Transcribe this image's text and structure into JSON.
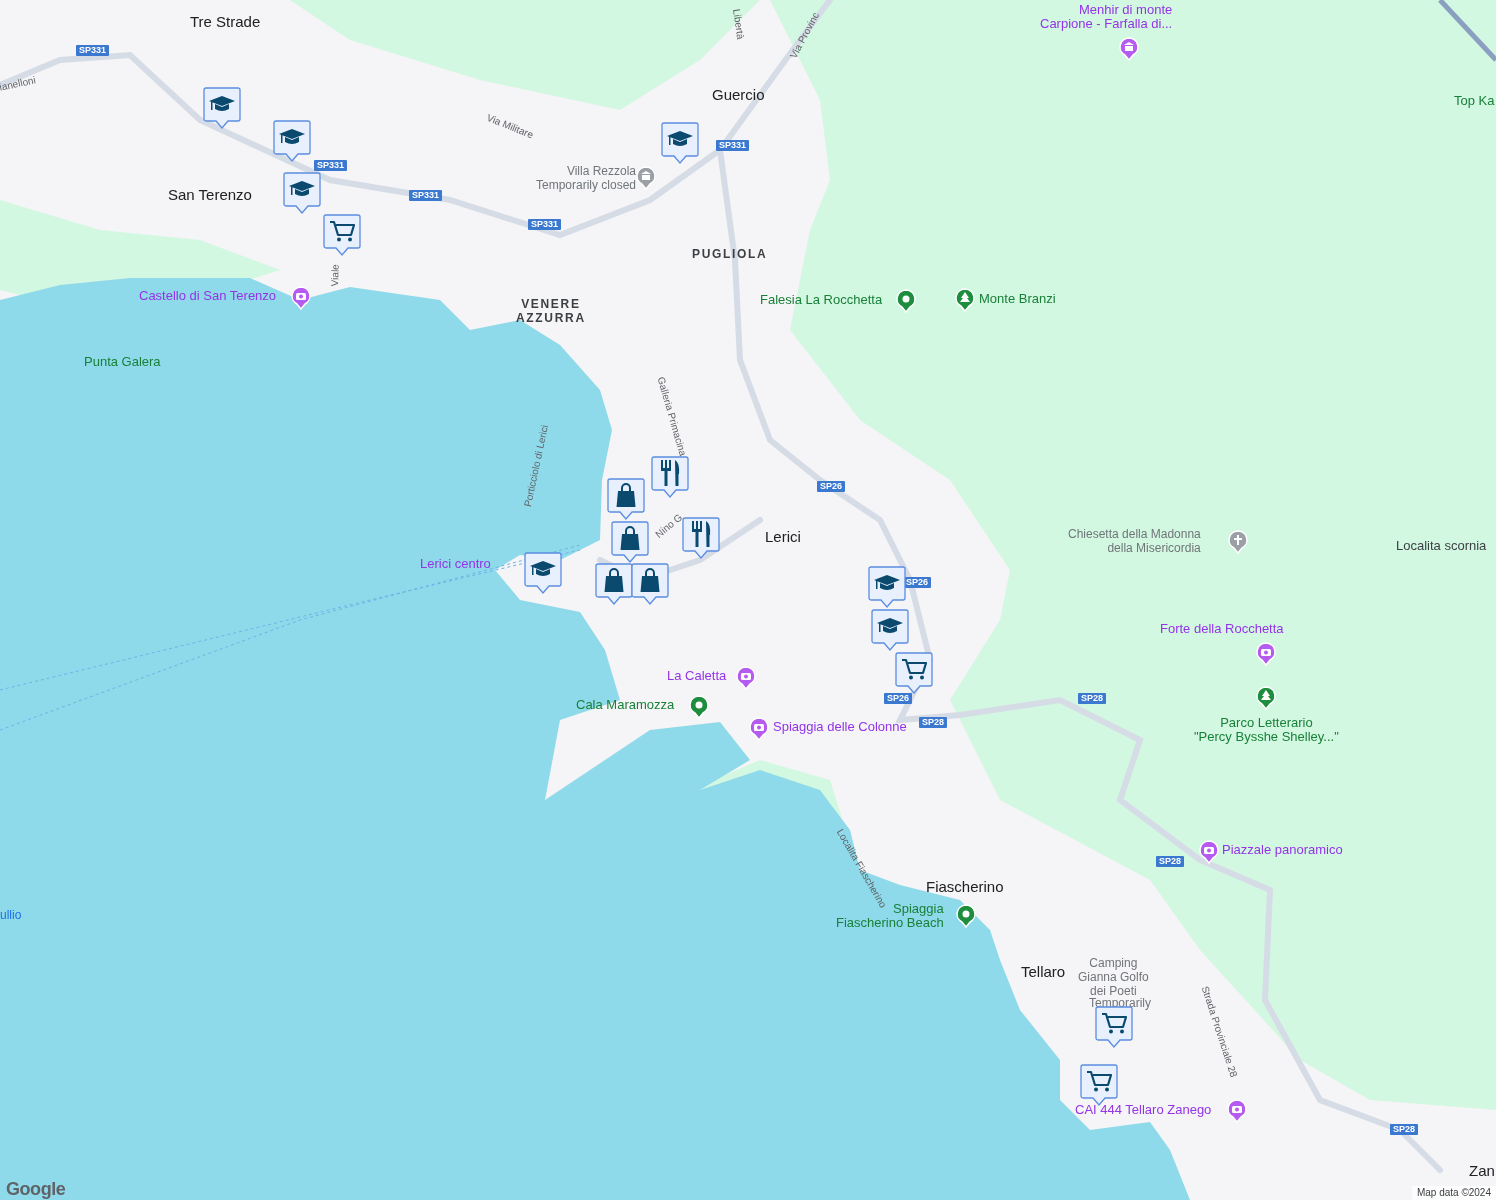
{
  "map": {
    "labels": [
      {
        "kind": "town",
        "lines": [
          "Tre Strade"
        ]
      },
      {
        "kind": "purple",
        "lines": [
          "Menhir di monte",
          "Carpione -  Farfalla di..."
        ]
      },
      {
        "kind": "street",
        "lines": [
          "Libertà"
        ]
      },
      {
        "kind": "street",
        "lines": [
          "Via Provinc"
        ]
      },
      {
        "kind": "street",
        "lines": [
          "ianelloni"
        ]
      },
      {
        "kind": "green",
        "lines": [
          "Top Ka"
        ]
      },
      {
        "kind": "town",
        "lines": [
          "Guercio"
        ]
      },
      {
        "kind": "street",
        "lines": [
          "Via Militare"
        ]
      },
      {
        "kind": "gray",
        "lines": [
          "Villa Rezzola",
          "Temporarily closed"
        ]
      },
      {
        "kind": "town",
        "lines": [
          "San Terenzo"
        ]
      },
      {
        "kind": "district",
        "lines": [
          "PUGLIOLA"
        ]
      },
      {
        "kind": "purple",
        "lines": [
          "Castello di San Terenzo"
        ]
      },
      {
        "kind": "street",
        "lines": [
          "Viale"
        ]
      },
      {
        "kind": "green",
        "lines": [
          "Falesia La Rocchetta"
        ]
      },
      {
        "kind": "green",
        "lines": [
          "Monte Branzi"
        ]
      },
      {
        "kind": "district",
        "lines": [
          "VENERE",
          "AZZURRA"
        ]
      },
      {
        "kind": "green",
        "lines": [
          "Punta Galera"
        ]
      },
      {
        "kind": "street",
        "lines": [
          "Galleria Primacina"
        ]
      },
      {
        "kind": "street",
        "lines": [
          "Porticciolo di Lerici"
        ]
      },
      {
        "kind": "street",
        "lines": [
          "Nino G"
        ]
      },
      {
        "kind": "town",
        "lines": [
          "Lerici"
        ]
      },
      {
        "kind": "gray",
        "lines": [
          "Chiesetta della Madonna",
          "della Misericordia"
        ]
      },
      {
        "kind": "locality",
        "lines": [
          "Localita scornia"
        ]
      },
      {
        "kind": "purple",
        "lines": [
          "Lerici centro"
        ]
      },
      {
        "kind": "purple",
        "lines": [
          "Forte della Rocchetta"
        ]
      },
      {
        "kind": "purple",
        "lines": [
          "La Caletta"
        ]
      },
      {
        "kind": "green",
        "lines": [
          "Cala Maramozza"
        ]
      },
      {
        "kind": "purple",
        "lines": [
          "Spiaggia delle Colonne"
        ]
      },
      {
        "kind": "green",
        "lines": [
          "Parco Letterario",
          "\"Percy Bysshe Shelley...\""
        ]
      },
      {
        "kind": "street",
        "lines": [
          "Localita Fiascherino"
        ]
      },
      {
        "kind": "purple",
        "lines": [
          "Piazzale panoramico"
        ]
      },
      {
        "kind": "town",
        "lines": [
          "Fiascherino"
        ]
      },
      {
        "kind": "water",
        "lines": [
          "ullio"
        ]
      },
      {
        "kind": "green",
        "lines": [
          "Spiaggia",
          "Fiascherino Beach"
        ]
      },
      {
        "kind": "street",
        "lines": [
          "Strada Provinciale 28"
        ]
      },
      {
        "kind": "town",
        "lines": [
          "Tellaro"
        ]
      },
      {
        "kind": "gray",
        "lines": [
          "Camping",
          "Gianna Golfo",
          "dei Poeti"
        ]
      },
      {
        "kind": "gray",
        "lines": [
          "Temporarily"
        ]
      },
      {
        "kind": "purple",
        "lines": [
          "CAI 444 Tellaro Zanego"
        ]
      },
      {
        "kind": "town",
        "lines": [
          "Zan"
        ]
      }
    ],
    "road_shields": [
      "SP331",
      "SP331",
      "SP331",
      "SP331",
      "SP331",
      "SP26",
      "SP26",
      "SP26",
      "SP28",
      "SP28",
      "SP28",
      "SP28"
    ],
    "logo": "Google",
    "attribution": "Map data ©2024"
  }
}
